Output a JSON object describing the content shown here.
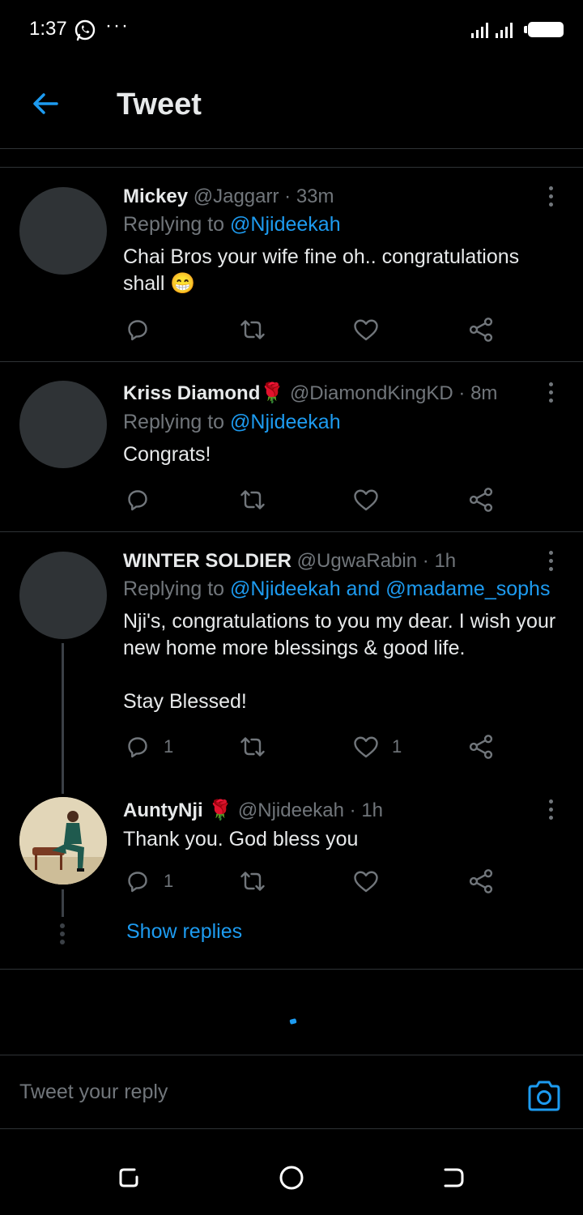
{
  "status_bar": {
    "time": "1:37",
    "dots": "···"
  },
  "header": {
    "title": "Tweet"
  },
  "tweets": [
    {
      "name": "Mickey",
      "handle": "@Jaggarr",
      "time": "· 33m",
      "replying_prefix": "Replying to ",
      "replying_mentions": "@Njideekah",
      "text": "Chai Bros your wife fine oh.. congratulations shall 😁"
    },
    {
      "name": "Kriss Diamond🌹",
      "handle": "@DiamondKingKD",
      "time": "· 8m",
      "replying_prefix": "Replying to ",
      "replying_mentions": "@Njideekah",
      "text": "Congrats!"
    },
    {
      "name": "WINTER SOLDIER",
      "handle": "@UgwaRabin",
      "time": "· 1h",
      "replying_prefix": "Replying to ",
      "replying_mentions": "@Njideekah and @madame_sophs",
      "text_line1": "Nji's, congratulations to you my dear. I wish your new home more blessings & good life.",
      "text_line2": "Stay Blessed!",
      "reply_count": "1",
      "like_count": "1"
    },
    {
      "name": "AuntyNji 🌹",
      "handle": "@Njideekah",
      "time": "· 1h",
      "text": "Thank you. God bless you",
      "reply_count": "1"
    }
  ],
  "show_replies": "Show replies",
  "composer": {
    "placeholder": "Tweet your reply"
  },
  "icons": {
    "back": "arrow-left-icon",
    "more": "more-vertical-icon",
    "reply": "reply-icon",
    "retweet": "retweet-icon",
    "like": "heart-icon",
    "share": "share-icon",
    "camera": "camera-icon"
  },
  "colors": {
    "accent": "#1d9bf0",
    "background": "#000000",
    "secondary_text": "#71767b",
    "divider": "#2f3336"
  }
}
